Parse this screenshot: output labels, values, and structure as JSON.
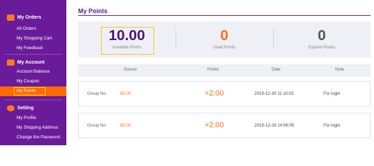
{
  "sidebar": {
    "sections": [
      {
        "title": "My Orders",
        "icon": "orders-icon",
        "items": [
          "All Orders",
          "My Shopping Cart",
          "My Feedback"
        ]
      },
      {
        "title": "My Account",
        "icon": "wallet-icon",
        "items": [
          "Account Balance",
          "My Coupon",
          "My Points"
        ],
        "active": "My Points"
      },
      {
        "title": "Setting",
        "icon": "gear-icon",
        "items": [
          "My Profile",
          "My Shipping Address",
          "Change the Password"
        ]
      }
    ],
    "accent": "#ff6b00",
    "background": "#6a1b9a"
  },
  "main": {
    "title": "My Points",
    "summary": {
      "available": {
        "value": "10.00",
        "label": "Available Points"
      },
      "used": {
        "value": "0",
        "label": "Used Points"
      },
      "expired": {
        "value": "0",
        "label": "Expired Points"
      }
    },
    "table": {
      "headers": [
        "Source",
        "Points",
        "Date",
        "Note"
      ],
      "rows": [
        {
          "source_label": "Group No:",
          "source_value": "$0.00",
          "points": "+2.00",
          "date": "2019-12-30 11:10:02",
          "note": "For login"
        },
        {
          "source_label": "Group No:",
          "source_value": "$0.00",
          "points": "+2.00",
          "date": "2019-12-26 14:06:05",
          "note": "For login"
        }
      ]
    }
  }
}
